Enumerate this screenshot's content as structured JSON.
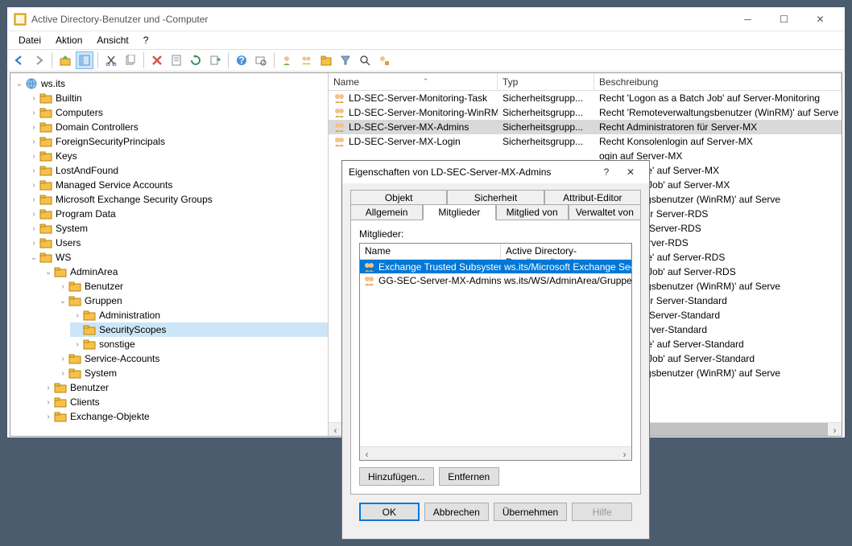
{
  "window": {
    "title": "Active Directory-Benutzer und -Computer",
    "menus": [
      "Datei",
      "Aktion",
      "Ansicht",
      "?"
    ]
  },
  "tree": {
    "root": "ws.its",
    "items": [
      "Builtin",
      "Computers",
      "Domain Controllers",
      "ForeignSecurityPrincipals",
      "Keys",
      "LostAndFound",
      "Managed Service Accounts",
      "Microsoft Exchange Security Groups",
      "Program Data",
      "System",
      "Users"
    ],
    "ws": "WS",
    "adminarea": "AdminArea",
    "admin_children": [
      "Benutzer"
    ],
    "gruppen": "Gruppen",
    "gruppen_children": [
      "Administration",
      "SecurityScopes",
      "sonstige"
    ],
    "admin_after": [
      "Service-Accounts",
      "System"
    ],
    "ws_after": [
      "Benutzer",
      "Clients",
      "Exchange-Objekte"
    ]
  },
  "list": {
    "columns": [
      "Name",
      "Typ",
      "Beschreibung"
    ],
    "rows": [
      {
        "n": "LD-SEC-Server-Monitoring-Task",
        "t": "Sicherheitsgrupp...",
        "d": "Recht 'Logon as a Batch Job' auf Server-Monitoring"
      },
      {
        "n": "LD-SEC-Server-Monitoring-WinRM",
        "t": "Sicherheitsgrupp...",
        "d": "Recht 'Remoteverwaltungsbenutzer (WinRM)' auf Serve"
      },
      {
        "n": "LD-SEC-Server-MX-Admins",
        "t": "Sicherheitsgrupp...",
        "d": "Recht Administratoren für Server-MX",
        "sel": true
      },
      {
        "n": "LD-SEC-Server-MX-Login",
        "t": "Sicherheitsgrupp...",
        "d": "Recht Konsolenlogin auf Server-MX"
      }
    ],
    "hidden": [
      "ogin auf Server-MX",
      " as a Service' auf Server-MX",
      " as a Batch Job' auf Server-MX",
      "everwaltungsbenutzer (WinRM)' auf Serve",
      "istratoren für Server-RDS",
      "enlogin auf Server-RDS",
      "ogin auf Server-RDS",
      " as a Service' auf Server-RDS",
      " as a Batch Job' auf Server-RDS",
      "everwaltungsbenutzer (WinRM)' auf Serve",
      "istratoren für Server-Standard",
      "enlogin auf Server-Standard",
      "ogin auf Server-Standard",
      " as a Service' auf Server-Standard",
      " as a Batch Job' auf Server-Standard",
      "everwaltungsbenutzer (WinRM)' auf Serve"
    ]
  },
  "dialog": {
    "title": "Eigenschaften von LD-SEC-Server-MX-Admins",
    "tabs_row1": [
      "Objekt",
      "Sicherheit",
      "Attribut-Editor"
    ],
    "tabs_row2": [
      "Allgemein",
      "Mitglieder",
      "Mitglied von",
      "Verwaltet von"
    ],
    "members_label": "Mitglieder:",
    "mcols": [
      "Name",
      "Active Directory-Domänendienste"
    ],
    "mrows": [
      {
        "n": "Exchange Trusted Subsystem",
        "p": "ws.its/Microsoft Exchange Secu",
        "sel": true
      },
      {
        "n": "GG-SEC-Server-MX-Admins",
        "p": "ws.its/WS/AdminArea/Gruppen/"
      }
    ],
    "add": "Hinzufügen...",
    "remove": "Entfernen",
    "ok": "OK",
    "cancel": "Abbrechen",
    "apply": "Übernehmen",
    "help": "Hilfe"
  }
}
